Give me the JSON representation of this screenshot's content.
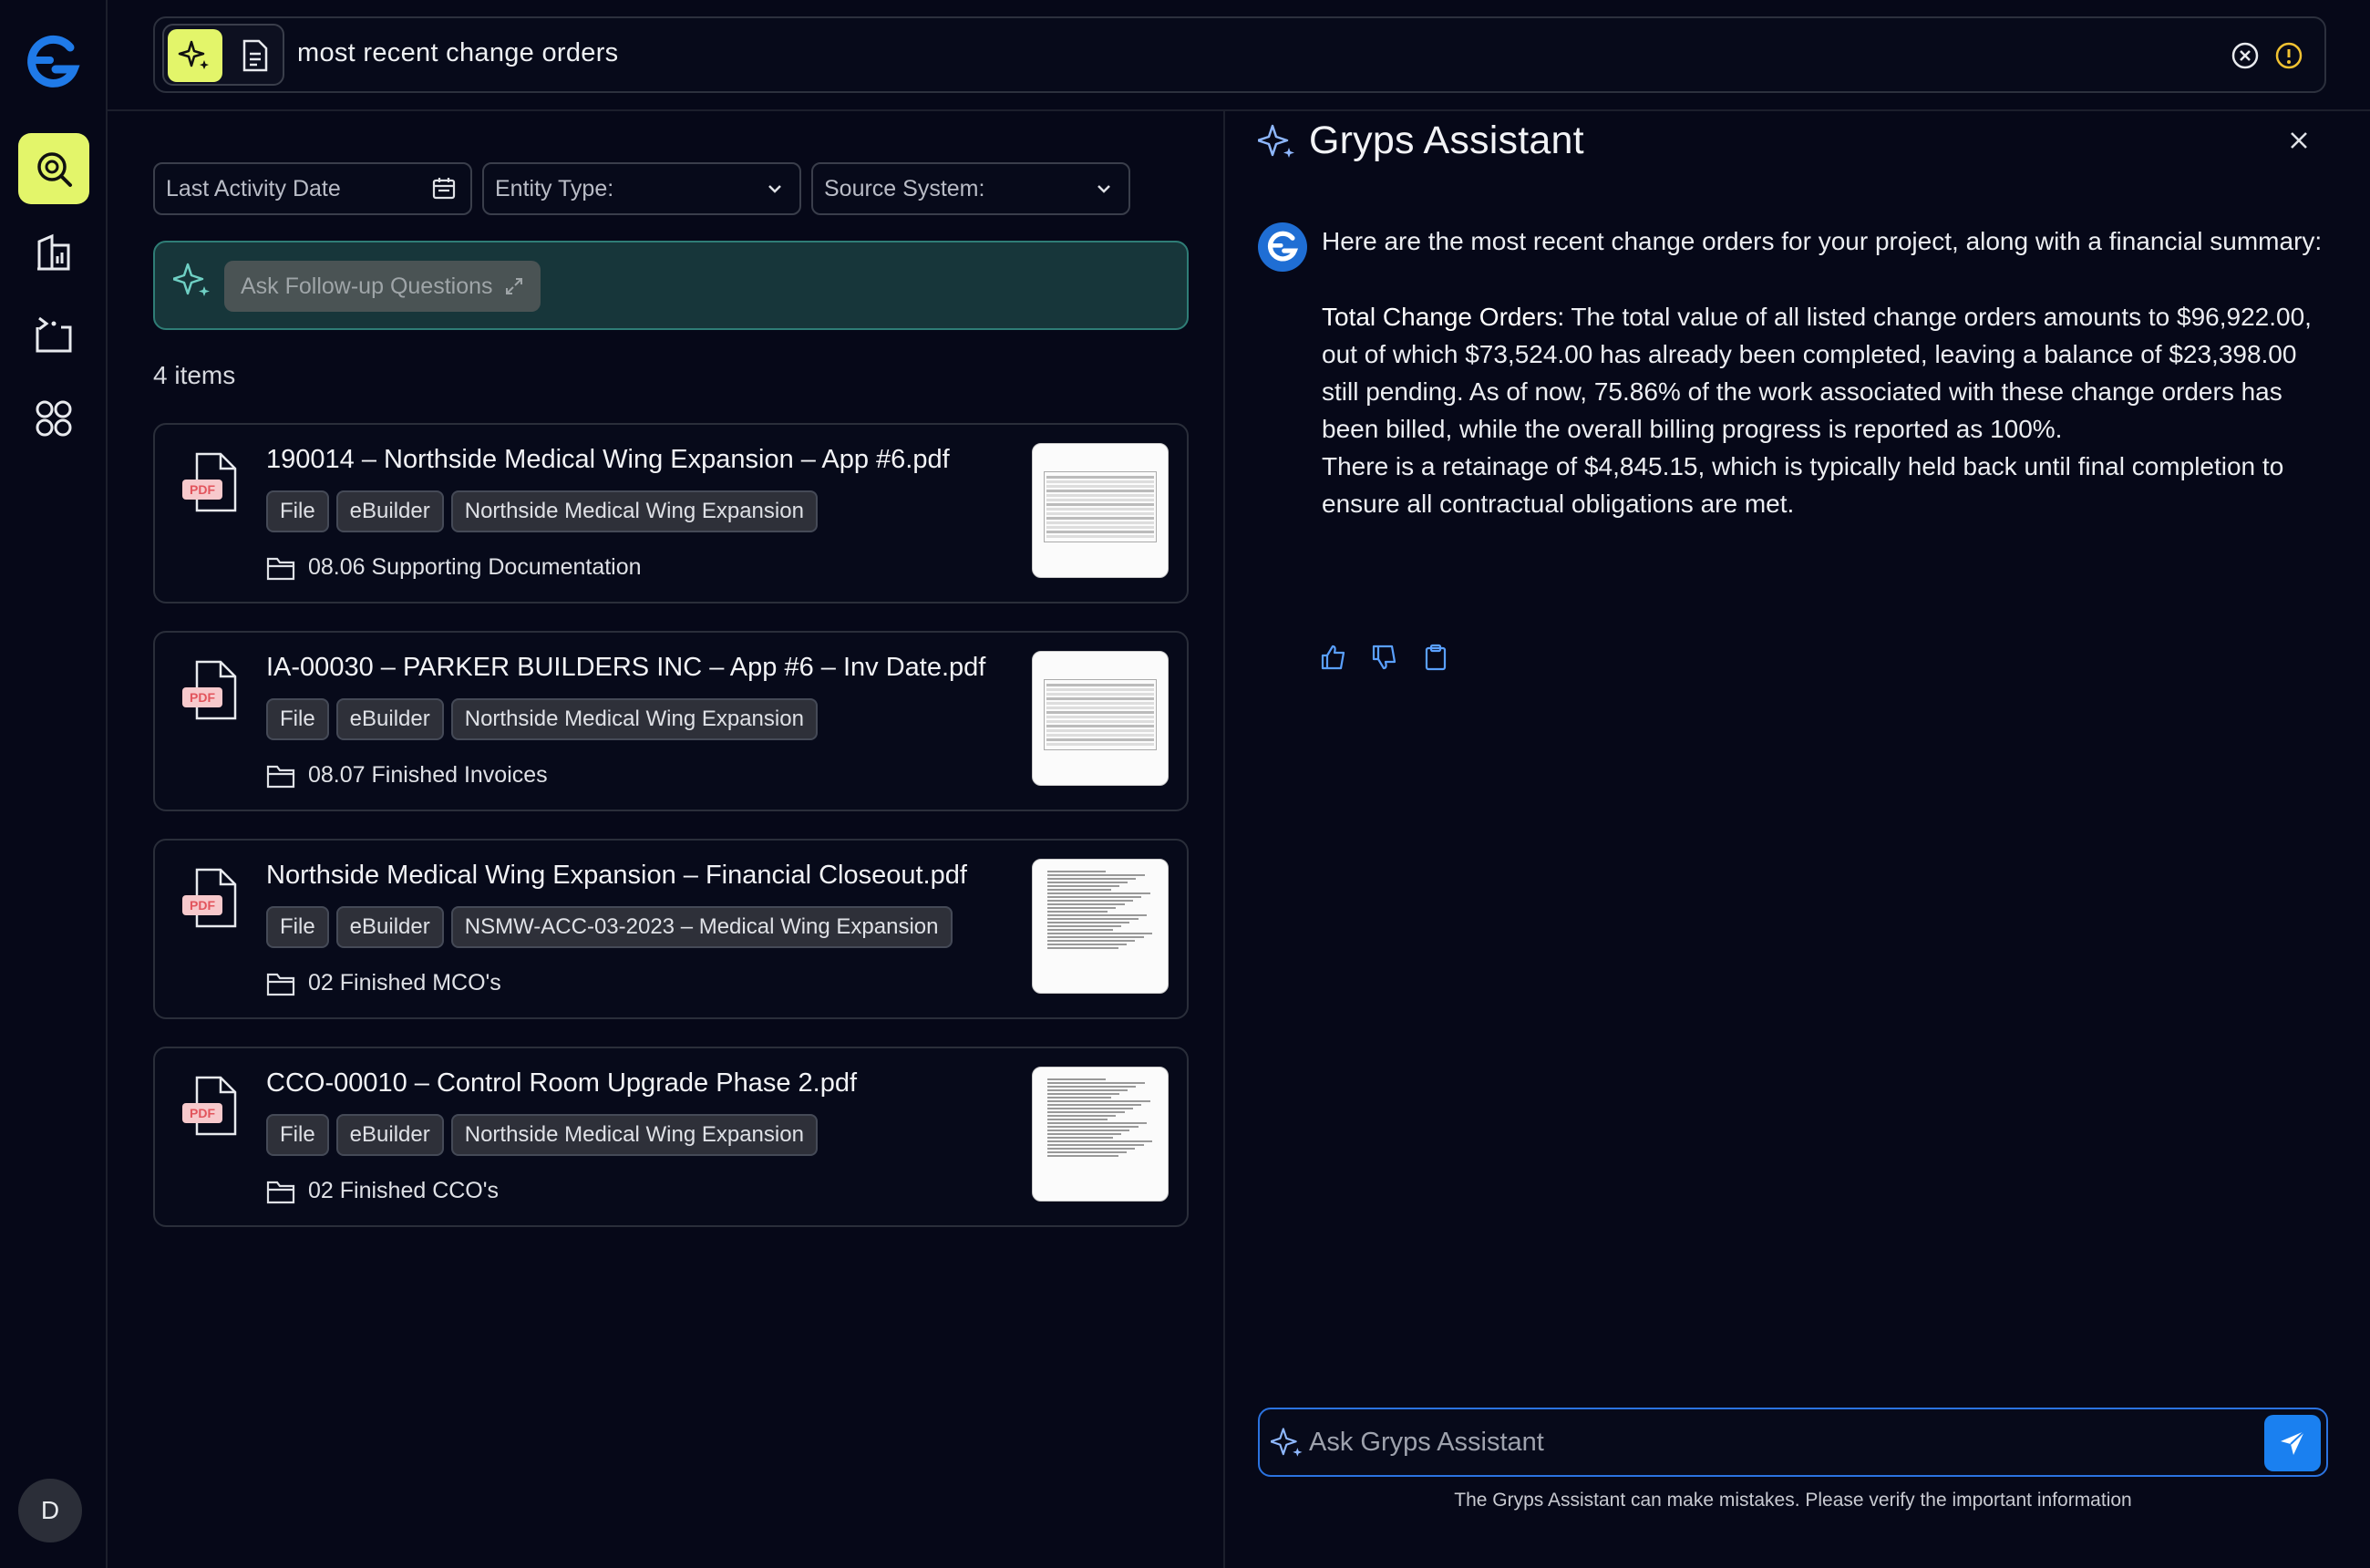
{
  "search": {
    "query": "most recent change orders"
  },
  "filters": [
    {
      "label": "Last Activity Date",
      "icon": "calendar-icon"
    },
    {
      "label": "Entity Type:",
      "icon": "chevron-down-icon"
    },
    {
      "label": "Source System:",
      "icon": "chevron-down-icon"
    }
  ],
  "followup": {
    "label": "Ask Follow-up Questions"
  },
  "results": {
    "count_label": "4 items",
    "pdf_badge": "PDF",
    "items": [
      {
        "title": "190014 – Northside Medical Wing Expansion – App #6.pdf",
        "tags": [
          "File",
          "eBuilder",
          "Northside Medical Wing Expansion"
        ],
        "folder": "08.06 Supporting Documentation",
        "thumb": "spreadsheet"
      },
      {
        "title": "IA-00030 – PARKER BUILDERS INC – App #6 – Inv Date.pdf",
        "tags": [
          "File",
          "eBuilder",
          "Northside Medical Wing Expansion"
        ],
        "folder": "08.07 Finished Invoices",
        "thumb": "spreadsheet"
      },
      {
        "title": "Northside Medical Wing Expansion – Financial Closeout.pdf",
        "tags": [
          "File",
          "eBuilder",
          "NSMW-ACC-03-2023 – Medical Wing Expansion"
        ],
        "folder": "02 Finished MCO's",
        "thumb": "text"
      },
      {
        "title": "CCO-00010 – Control Room Upgrade Phase 2.pdf",
        "tags": [
          "File",
          "eBuilder",
          "Northside Medical Wing Expansion"
        ],
        "folder": "02 Finished CCO's",
        "thumb": "text"
      }
    ]
  },
  "assistant": {
    "title": "Gryps Assistant",
    "message": {
      "intro": "Here are the most recent change orders for your project, along with a financial summary:",
      "bold_label": "Total Change Orders:",
      "para1": "The total value of all listed change orders amounts to $96,922.00, out of which $73,524.00 has already been completed, leaving a balance of $23,398.00 still pending. As of now, 75.86% of the work associated with these change orders has been billed, while the overall billing progress is reported as 100%.",
      "para2": "There is a retainage of $4,845.15, which is typically held back until final completion to ensure all contractual obligations are met."
    },
    "input_placeholder": "Ask Gryps Assistant",
    "disclaimer": "The Gryps Assistant can make mistakes. Please verify the important information"
  },
  "user": {
    "initial": "D"
  },
  "colors": {
    "background": "#060818",
    "accent_lime": "#e3f56a",
    "accent_blue": "#1a80f0",
    "followup_bg": "#17363a",
    "pdf_red": "#e2545c"
  }
}
